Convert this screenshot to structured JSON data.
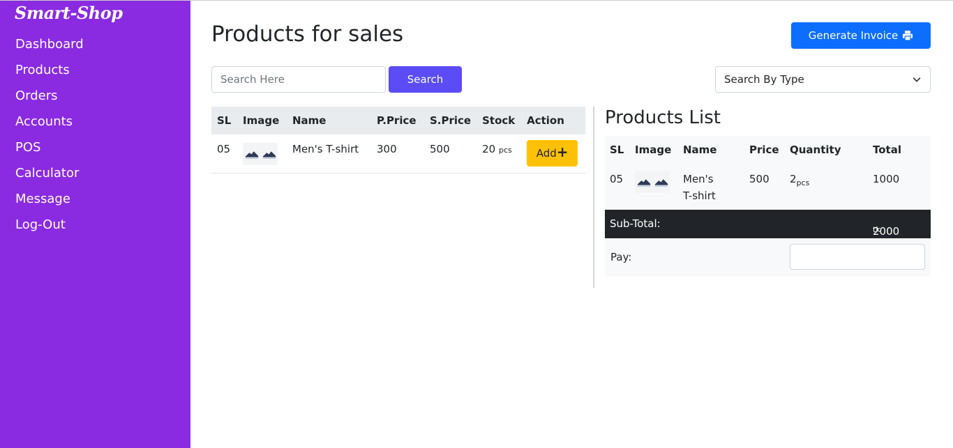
{
  "sidebar": {
    "brand": "Smart-Shop",
    "items": [
      "Dashboard",
      "Products",
      "Orders",
      "Accounts",
      "POS",
      "Calculator",
      "Message",
      "Log-Out"
    ]
  },
  "header": {
    "title": "Products for sales",
    "generate_invoice": "Generate Invoice",
    "invoice_icon": "printer-icon"
  },
  "search": {
    "placeholder": "Search Here",
    "button": "Search",
    "type_select": "Search By Type"
  },
  "products_table": {
    "headers": [
      "SL",
      "Image",
      "Name",
      "P.Price",
      "S.Price",
      "Stock",
      "Action"
    ],
    "rows": [
      {
        "sl": "05",
        "name": "Men's T-shirt",
        "p_price": "300",
        "s_price": "500",
        "stock": "20",
        "stock_unit": "pcs",
        "action": "Add"
      }
    ]
  },
  "products_list": {
    "title": "Products List",
    "headers": [
      "SL",
      "Image",
      "Name",
      "Price",
      "Quantity",
      "Total"
    ],
    "rows": [
      {
        "sl": "05",
        "name_line1": "Men's",
        "name_line2": "T-shirt",
        "price": "500",
        "qty": "2",
        "qty_unit": "pcs",
        "total": "1000"
      }
    ],
    "subtotal_label": "Sub-Total:",
    "subtotal_value": "2000",
    "subtotal_unit": "tk",
    "pay_label": "Pay:"
  }
}
